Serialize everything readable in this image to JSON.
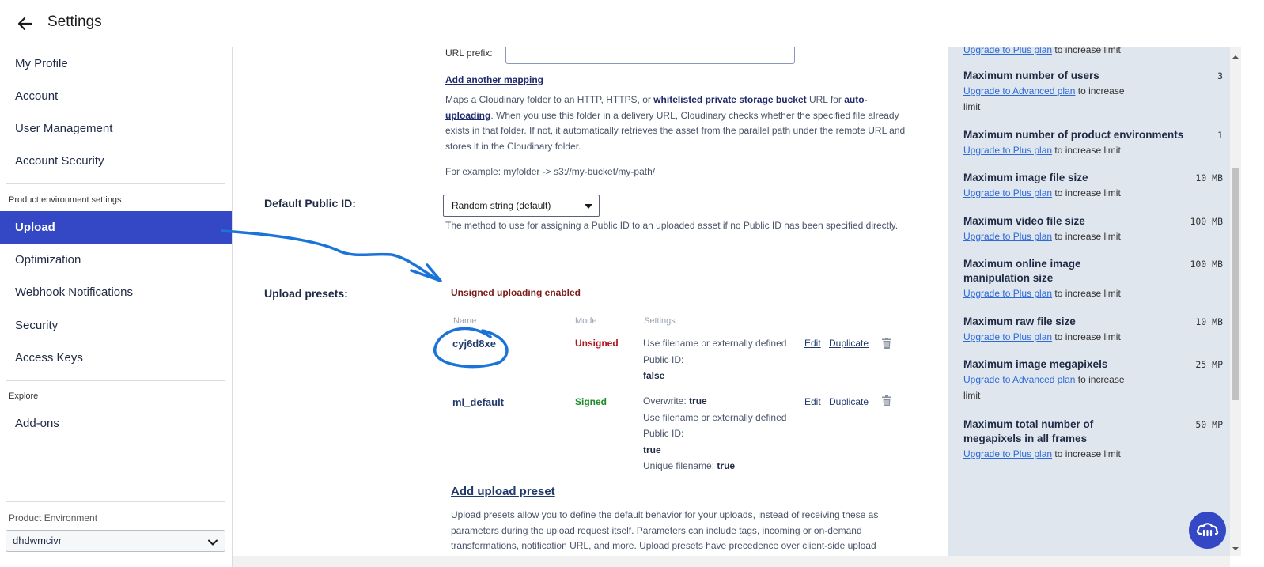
{
  "header": {
    "title": "Settings"
  },
  "sidebar": {
    "items_top": [
      "My Profile",
      "Account",
      "User Management",
      "Account Security"
    ],
    "section_product": "Product environment settings",
    "items_product": [
      "Upload",
      "Optimization",
      "Webhook Notifications",
      "Security",
      "Access Keys"
    ],
    "active_item": "Upload",
    "section_explore": "Explore",
    "items_explore": [
      "Add-ons"
    ],
    "env_label": "Product Environment",
    "env_value": "dhdwmcivr"
  },
  "main": {
    "url_prefix_label": "URL prefix:",
    "url_prefix_value": "",
    "add_mapping": "Add another mapping",
    "mapping_desc": {
      "p1": "Maps a Cloudinary folder to an HTTP, HTTPS, or ",
      "link1": "whitelisted private storage bucket",
      "p2": " URL for ",
      "link2": "auto-uploading",
      "p3": ". When you use this folder in a delivery URL, Cloudinary checks whether the specified file already exists in that folder. If not, it automatically retrieves the asset from the parallel path under the remote URL and stores it in the Cloudinary folder."
    },
    "example": "For example: myfolder -> s3://my-bucket/my-path/",
    "default_public_id": {
      "label": "Default Public ID:",
      "value": "Random string (default)",
      "desc": "The method to use for assigning a Public ID to an uploaded asset if no Public ID has been specified directly."
    },
    "upload_presets": {
      "label": "Upload presets:",
      "status": "Unsigned uploading enabled",
      "headers": {
        "name": "Name",
        "mode": "Mode",
        "settings": "Settings"
      },
      "rows": [
        {
          "name": "cyj6d8xe",
          "mode": "Unsigned",
          "s1": "Use filename or externally defined Public ID:",
          "s1_val": "false",
          "edit": "Edit",
          "duplicate": "Duplicate"
        },
        {
          "name": "ml_default",
          "mode": "Signed",
          "s0": "Overwrite:",
          "s0_val": "true",
          "s1": "Use filename or externally defined Public ID:",
          "s1_val": "true",
          "s2": "Unique filename:",
          "s2_val": "true",
          "edit": "Edit",
          "duplicate": "Duplicate"
        }
      ],
      "add_preset": "Add upload preset",
      "desc": "Upload presets allow you to define the default behavior for your uploads, instead of receiving these as parameters during the upload request itself. Parameters can include tags, incoming or on-demand transformations, notification URL, and more. Upload presets have precedence over client-side upload"
    }
  },
  "limits": {
    "top_partial": {
      "link": "Upgrade to Plus plan",
      "text": " to increase limit"
    },
    "items": [
      {
        "title": "Maximum number of users",
        "value": "3",
        "link": "Upgrade to Advanced plan",
        "text": " to increase limit"
      },
      {
        "title": "Maximum number of product environments",
        "value": "1",
        "link": "Upgrade to Plus plan",
        "text": " to increase limit"
      },
      {
        "title": "Maximum image file size",
        "value": "10 MB",
        "link": "Upgrade to Plus plan",
        "text": " to increase limit"
      },
      {
        "title": "Maximum video file size",
        "value": "100 MB",
        "link": "Upgrade to Plus plan",
        "text": " to increase limit"
      },
      {
        "title": "Maximum online image manipulation size",
        "value": "100 MB",
        "link": "Upgrade to Plus plan",
        "text": " to increase limit"
      },
      {
        "title": "Maximum raw file size",
        "value": "10 MB",
        "link": "Upgrade to Plus plan",
        "text": " to increase limit"
      },
      {
        "title": "Maximum image megapixels",
        "value": "25 MP",
        "link": "Upgrade to Advanced plan",
        "text": " to increase limit"
      },
      {
        "title": "Maximum total number of megapixels in all frames",
        "value": "50 MP",
        "link": "Upgrade to Plus plan",
        "text": " to increase limit"
      }
    ]
  },
  "colors": {
    "accent": "#3448c5",
    "annotation": "#1a73d9",
    "unsigned": "#b0161f",
    "signed": "#1a8a2a",
    "panel": "#dfe6ee"
  },
  "icons": {
    "back": "arrow-left-icon",
    "chevron": "chevron-down-icon",
    "trash": "trash-icon",
    "chat": "cloud-chat-icon"
  }
}
